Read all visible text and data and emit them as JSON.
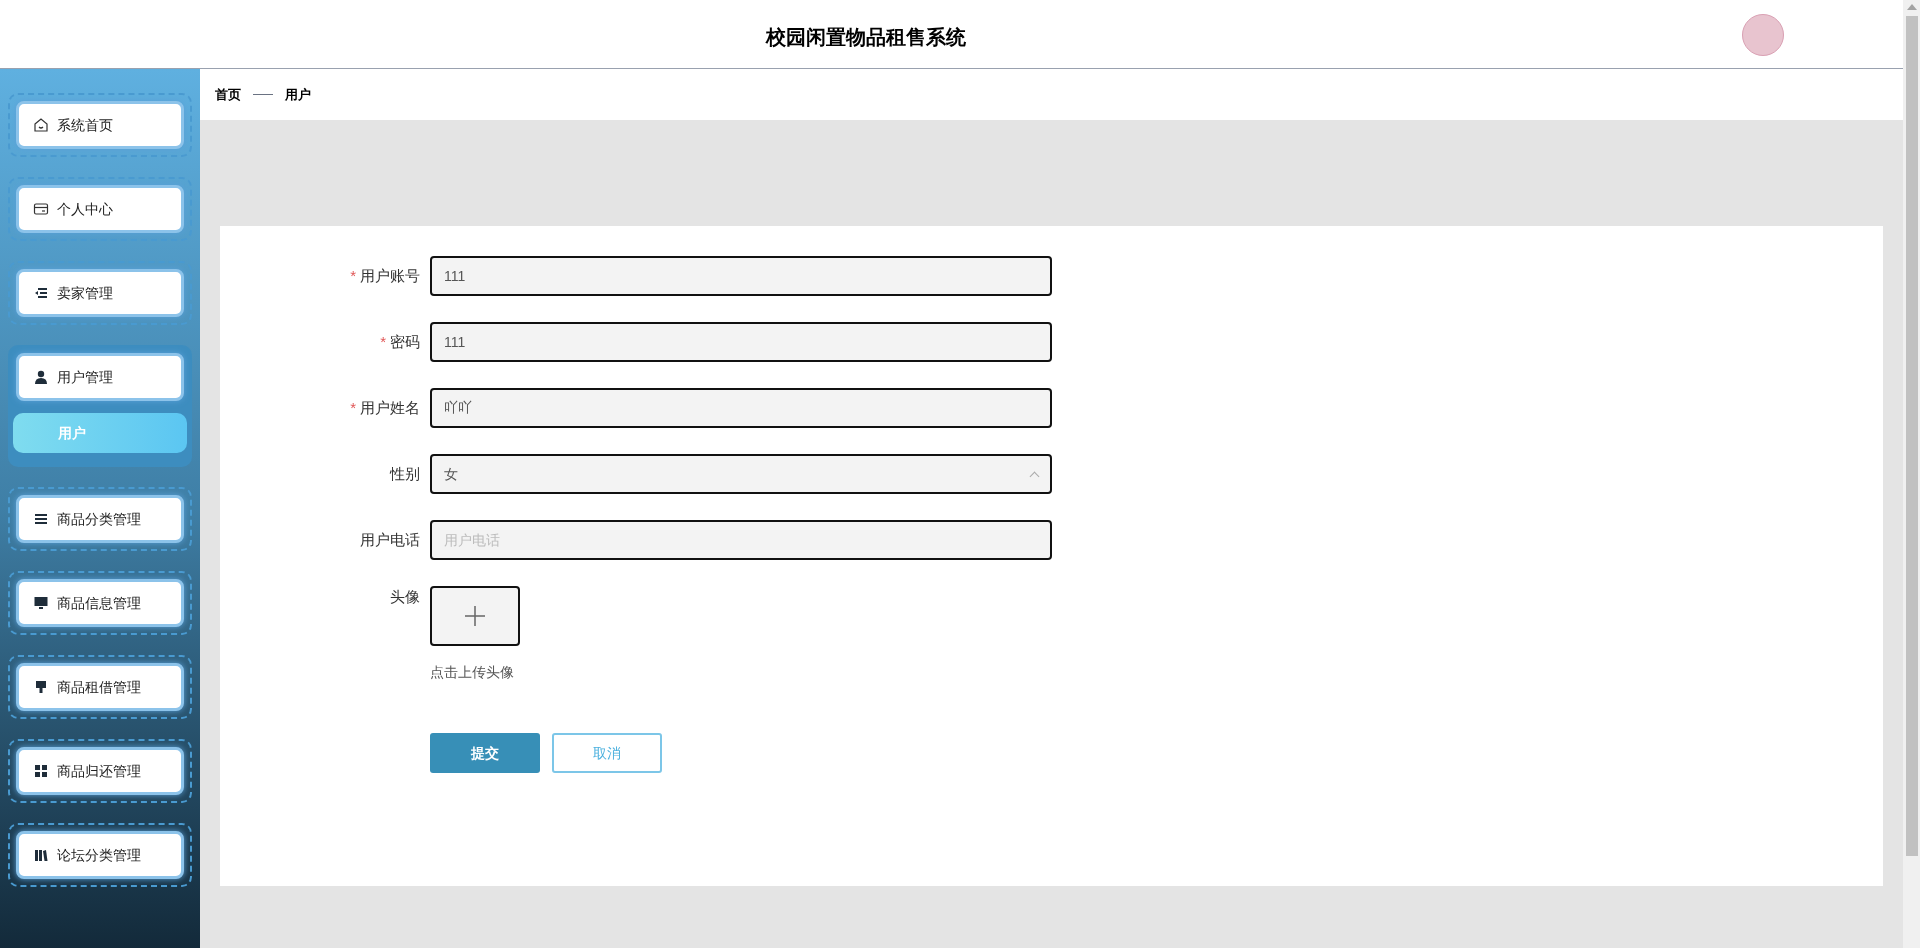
{
  "header": {
    "title": "校园闲置物品租售系统"
  },
  "sidebar": {
    "items": [
      {
        "label": "系统首页",
        "expanded": false
      },
      {
        "label": "个人中心",
        "expanded": false
      },
      {
        "label": "卖家管理",
        "expanded": false
      },
      {
        "label": "用户管理",
        "expanded": true,
        "children": [
          {
            "label": "用户",
            "selected": true
          }
        ]
      },
      {
        "label": "商品分类管理",
        "expanded": false
      },
      {
        "label": "商品信息管理",
        "expanded": false
      },
      {
        "label": "商品租借管理",
        "expanded": false
      },
      {
        "label": "商品归还管理",
        "expanded": false
      },
      {
        "label": "论坛分类管理",
        "expanded": false
      }
    ]
  },
  "breadcrumb": [
    "首页",
    "用户"
  ],
  "form": {
    "fields": [
      {
        "kind": "text",
        "required_mark": "*",
        "label": "用户账号",
        "value": "111"
      },
      {
        "kind": "text",
        "required_mark": "*",
        "label": "密码",
        "value": "111"
      },
      {
        "kind": "text",
        "required_mark": "*",
        "label": "用户姓名",
        "value": "吖吖"
      },
      {
        "kind": "select",
        "label": "性别",
        "value": "女"
      },
      {
        "kind": "text",
        "label": "用户电话",
        "placeholder": "用户电话"
      },
      {
        "kind": "upload",
        "label": "头像",
        "hint": "点击上传头像"
      }
    ],
    "buttons": [
      {
        "label": "提交",
        "kind": "primary"
      },
      {
        "label": "取消",
        "kind": "secondary"
      }
    ]
  }
}
